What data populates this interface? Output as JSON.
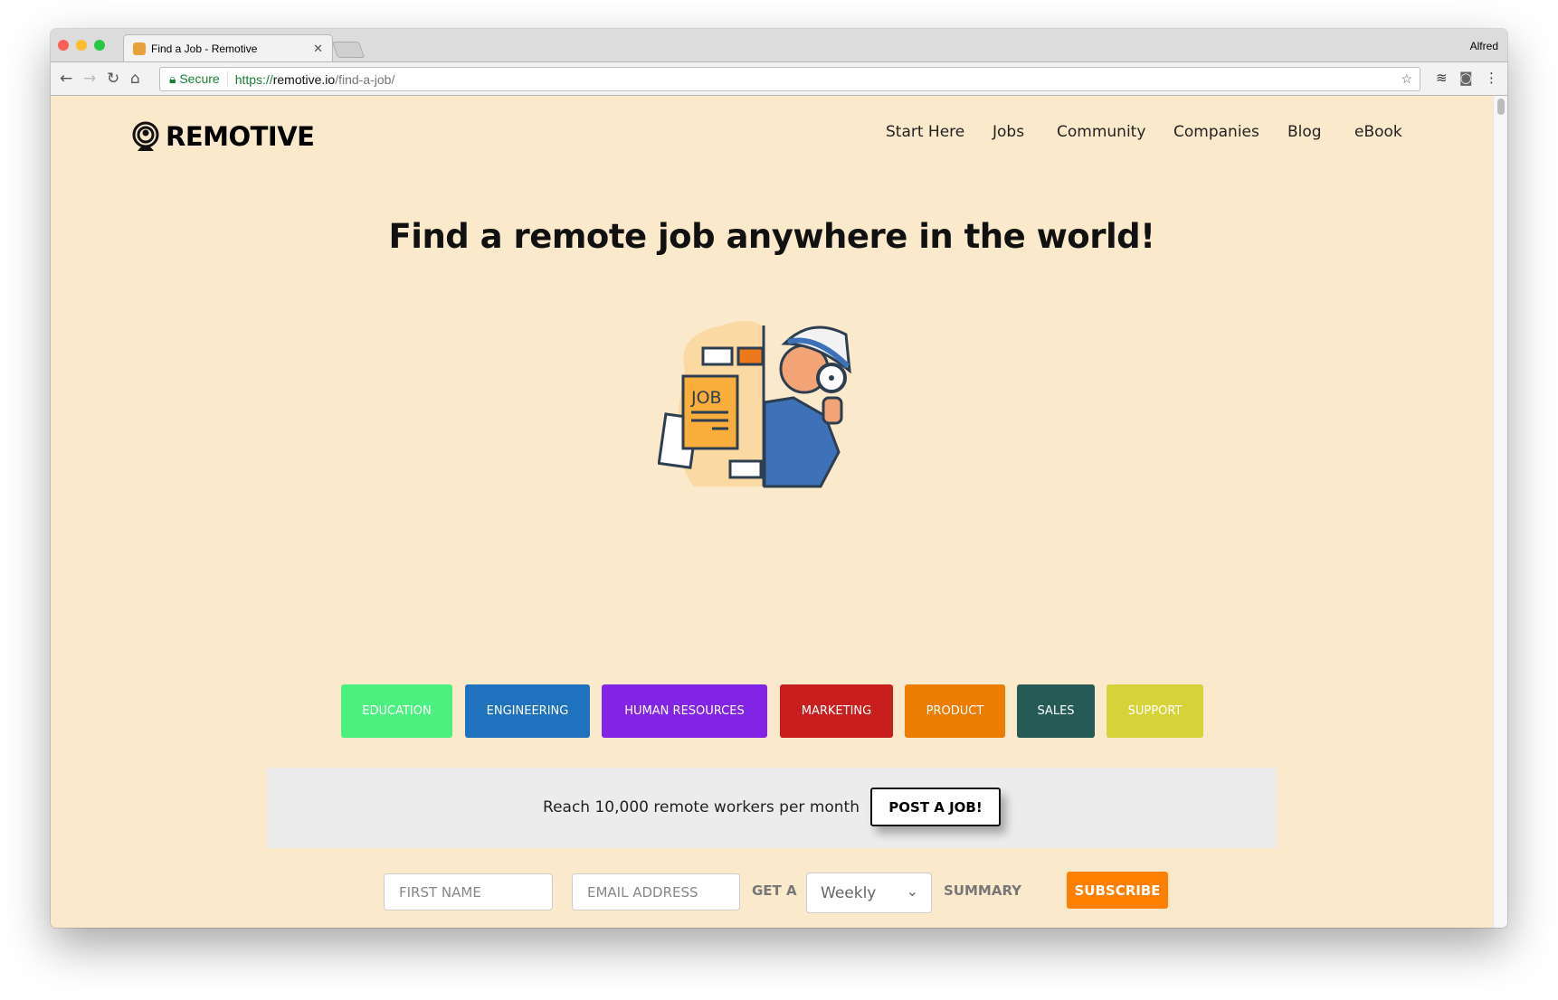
{
  "browser": {
    "tab_title": "Find a Job - Remotive",
    "user": "Alfred",
    "secure_label": "Secure",
    "url_scheme": "https://",
    "url_host": "remotive.io",
    "url_path": "/find-a-job/"
  },
  "header": {
    "logo": "REMOTIVE",
    "nav": [
      "Start Here",
      "Jobs",
      "Community",
      "Companies",
      "Blog",
      "eBook"
    ]
  },
  "hero": {
    "title": "Find a remote job anywhere in the world!",
    "illustration_text": "JOB"
  },
  "categories": [
    {
      "label": "EDUCATION",
      "color": "#4cf07f"
    },
    {
      "label": "ENGINEERING",
      "color": "#1f72bd"
    },
    {
      "label": "HUMAN RESOURCES",
      "color": "#8224e3"
    },
    {
      "label": "MARKETING",
      "color": "#c81e1e"
    },
    {
      "label": "PRODUCT",
      "color": "#eb7d00"
    },
    {
      "label": "SALES",
      "color": "#265a56"
    },
    {
      "label": "SUPPORT",
      "color": "#d6d23a"
    }
  ],
  "promo": {
    "text": "Reach 10,000 remote workers per month",
    "button": "POST A JOB!"
  },
  "subscribe": {
    "first_name_placeholder": "FIRST NAME",
    "email_placeholder": "EMAIL ADDRESS",
    "get_a": "GET A",
    "frequency": "Weekly",
    "summary": "SUMMARY",
    "button": "SUBSCRIBE",
    "button_color": "#ff8000"
  }
}
